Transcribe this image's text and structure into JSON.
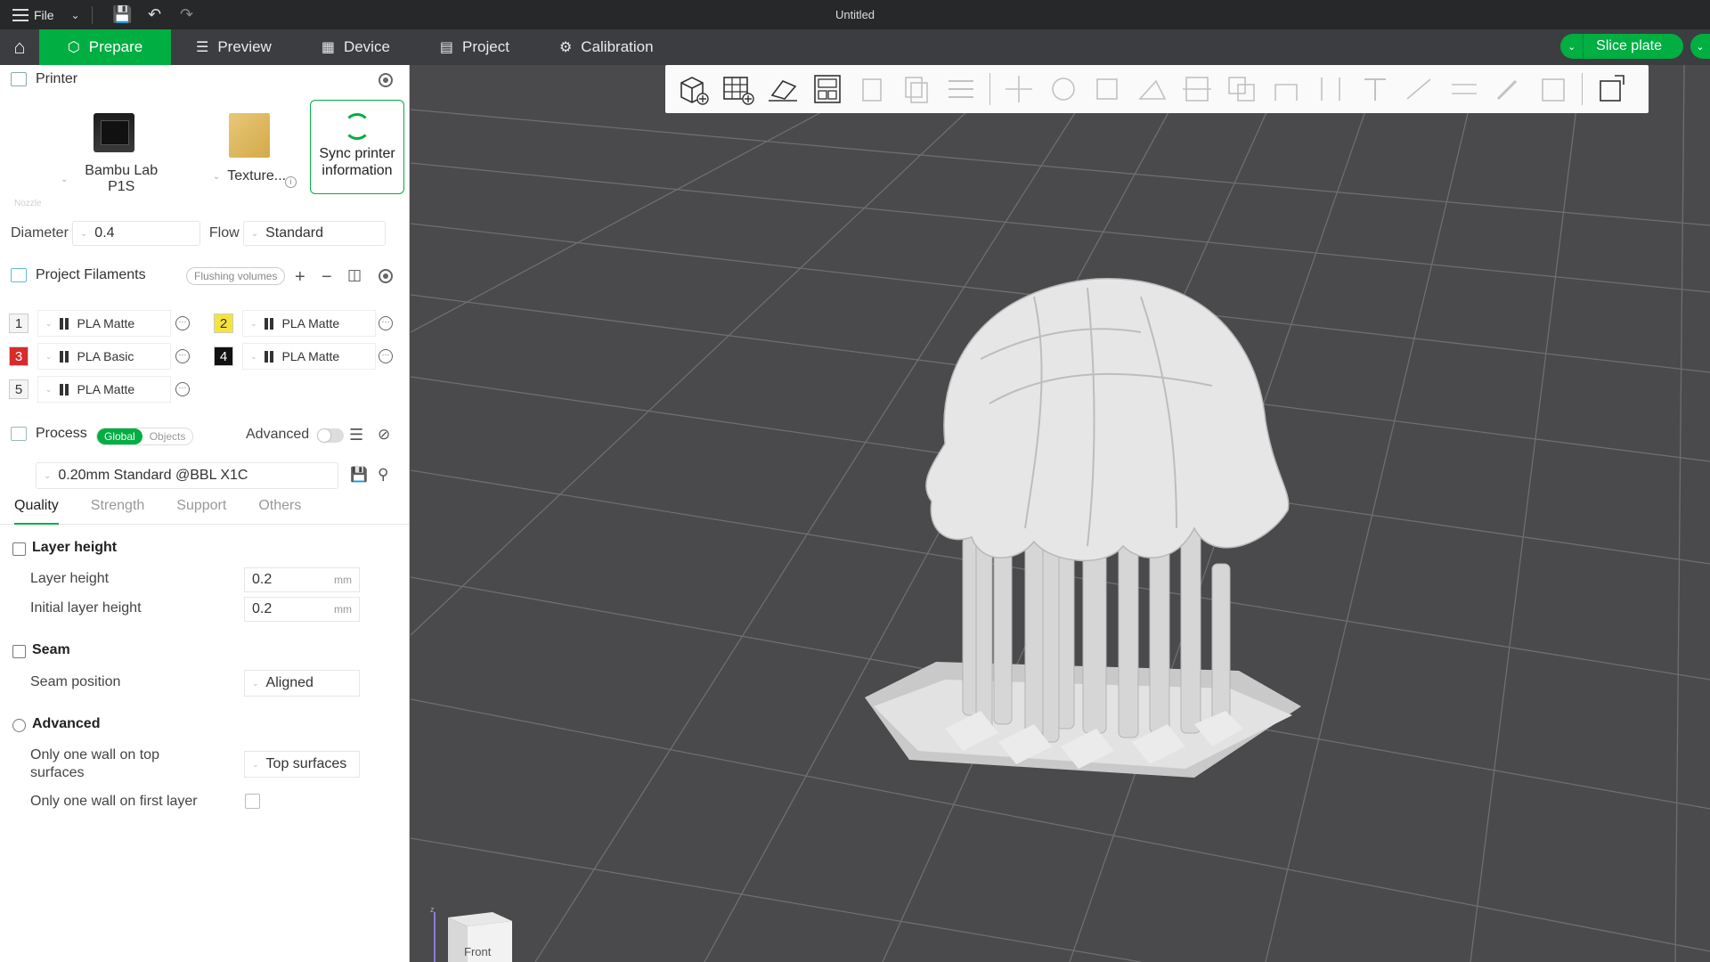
{
  "titlebar": {
    "file_label": "File",
    "title": "Untitled"
  },
  "nav": {
    "tabs": [
      {
        "label": "Prepare",
        "icon": "cube-icon"
      },
      {
        "label": "Preview",
        "icon": "layers-icon"
      },
      {
        "label": "Device",
        "icon": "device-icon"
      },
      {
        "label": "Project",
        "icon": "project-icon"
      },
      {
        "label": "Calibration",
        "icon": "calibration-icon"
      }
    ],
    "slice_label": "Slice plate"
  },
  "printer": {
    "heading": "Printer",
    "model": "Bambu Lab P1S",
    "plate": "Texture...",
    "sync_label": "Sync printer information",
    "nozzle_label": "Nozzle",
    "diameter_label": "Diameter",
    "diameter_value": "0.4",
    "flow_label": "Flow",
    "flow_value": "Standard"
  },
  "filaments": {
    "heading": "Project Filaments",
    "flushing_label": "Flushing volumes",
    "items": [
      {
        "num": "1",
        "name": "PLA Matte",
        "color": "#f4f4f4",
        "text_color": "#333333"
      },
      {
        "num": "2",
        "name": "PLA Matte",
        "color": "#f5e43a",
        "text_color": "#333333"
      },
      {
        "num": "3",
        "name": "PLA Basic",
        "color": "#d82b2b",
        "text_color": "#ffffff"
      },
      {
        "num": "4",
        "name": "PLA Matte",
        "color": "#111111",
        "text_color": "#ffffff"
      },
      {
        "num": "5",
        "name": "PLA Matte",
        "color": "#f4f4f4",
        "text_color": "#333333"
      }
    ]
  },
  "process": {
    "heading": "Process",
    "global_label": "Global",
    "objects_label": "Objects",
    "advanced_label": "Advanced",
    "advanced_on": false,
    "preset": "0.20mm Standard @BBL X1C",
    "tabs": [
      "Quality",
      "Strength",
      "Support",
      "Others"
    ],
    "groups": {
      "layer_height": {
        "title": "Layer height",
        "layer_height_label": "Layer height",
        "layer_height_value": "0.2",
        "initial_label": "Initial layer height",
        "initial_value": "0.2",
        "unit": "mm"
      },
      "seam": {
        "title": "Seam",
        "position_label": "Seam position",
        "position_value": "Aligned"
      },
      "advanced": {
        "title": "Advanced",
        "one_wall_top_label": "Only one wall on top surfaces",
        "one_wall_top_value": "Top surfaces",
        "one_wall_first_label": "Only one wall on first layer",
        "one_wall_first_checked": false
      }
    }
  },
  "viewport": {
    "navcube_label": "Front",
    "model_color": "#dcdcdc",
    "bed_color": "#4a4a4c",
    "grid_color": "#6d6d70"
  },
  "colors": {
    "accent": "#00ae42",
    "titlebar": "#262829",
    "navbar": "#3b3d40"
  }
}
